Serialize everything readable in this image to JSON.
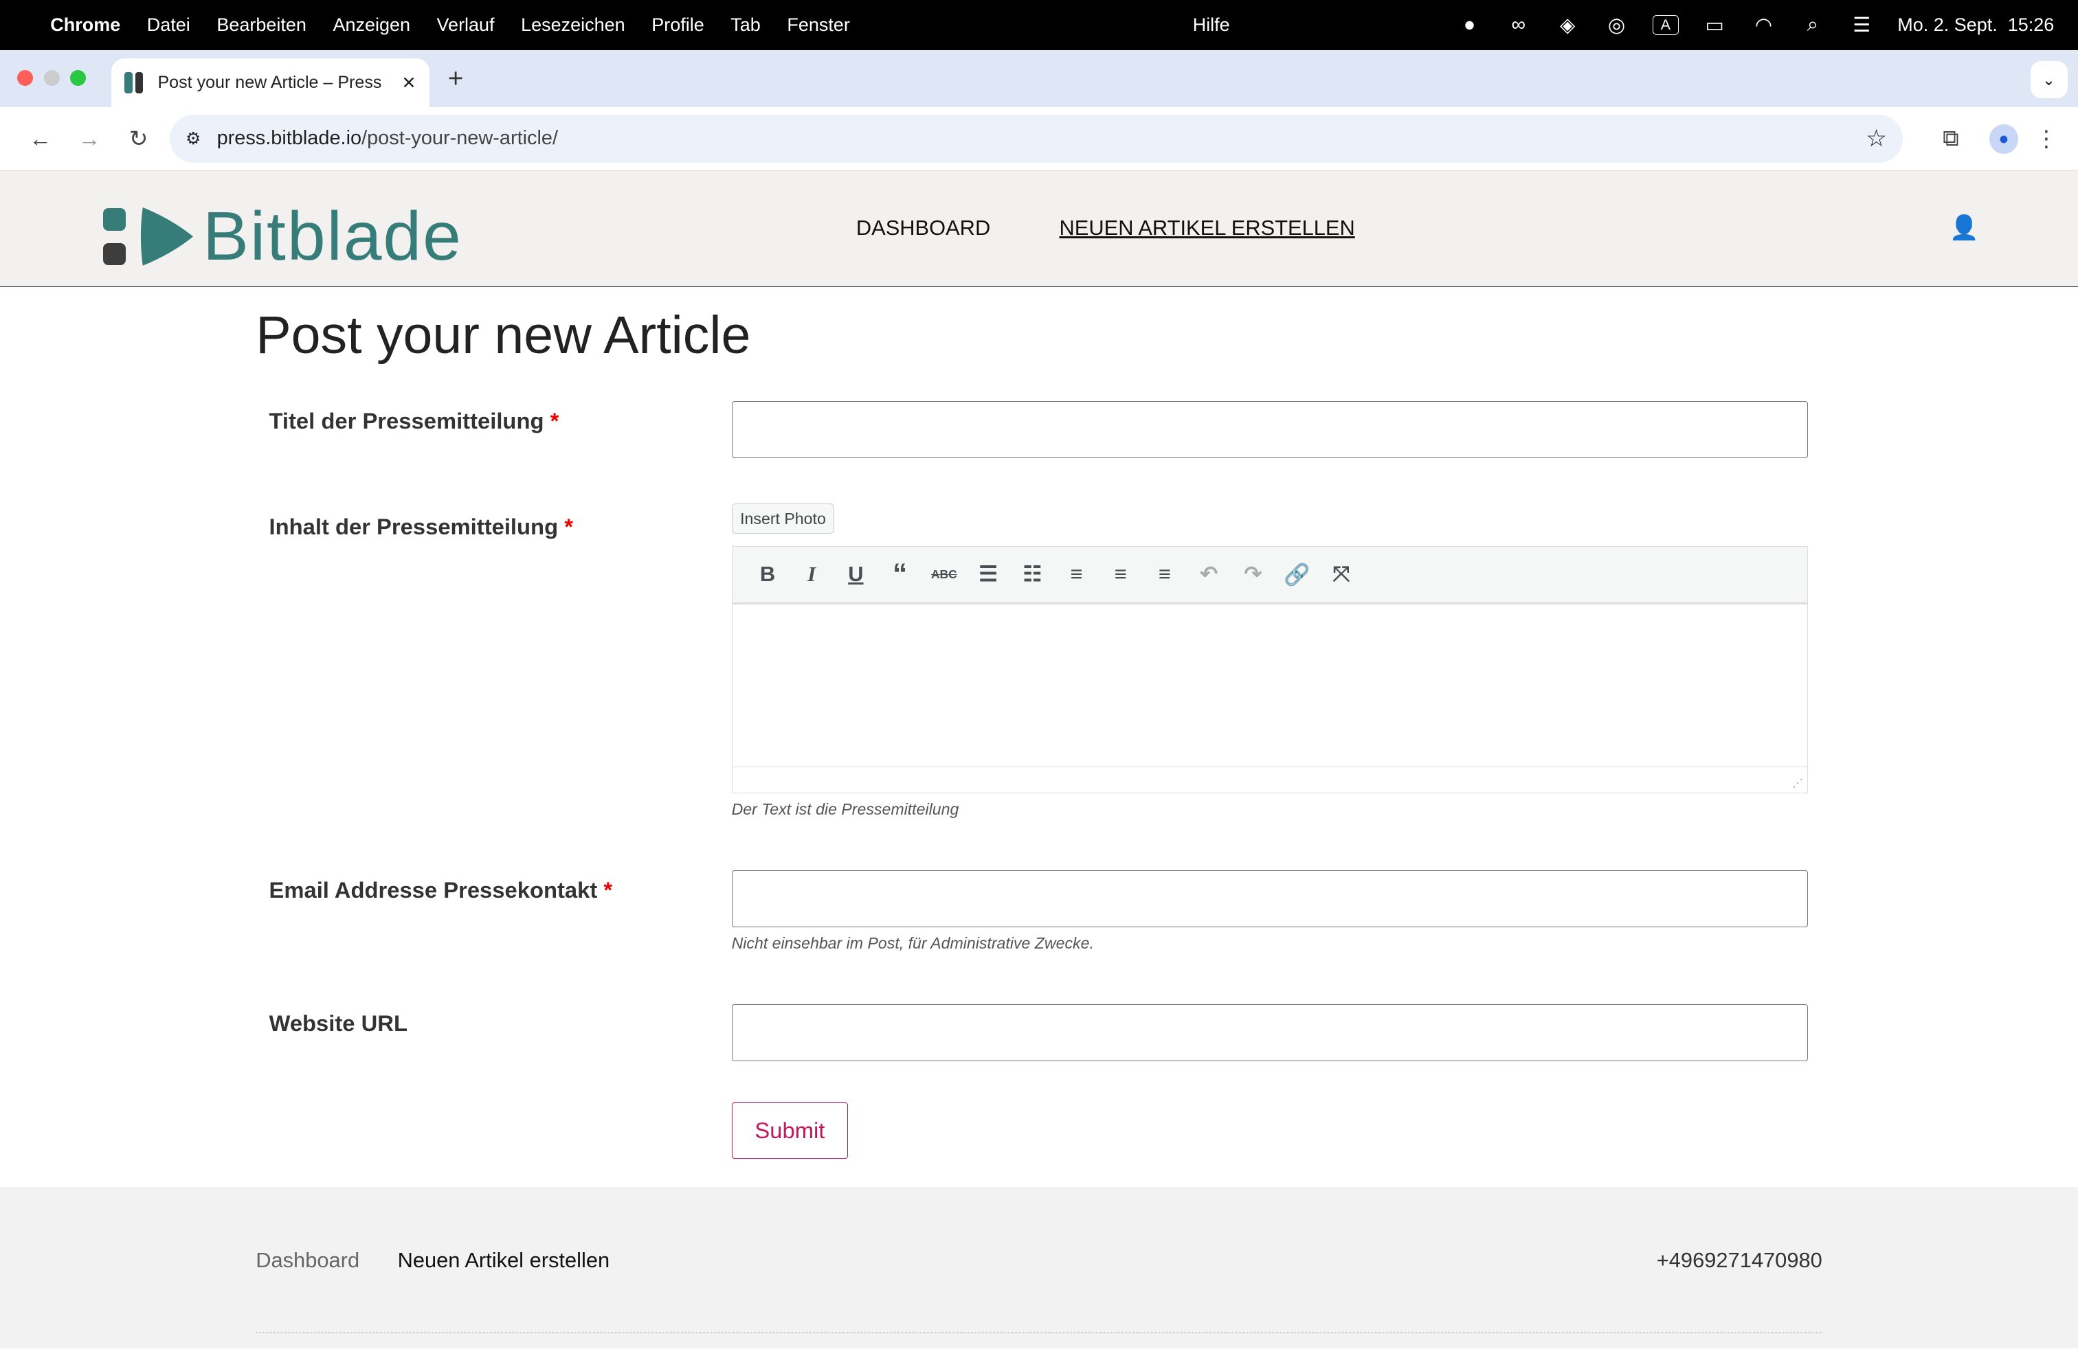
{
  "menubar": {
    "app": "Chrome",
    "items": [
      "Datei",
      "Bearbeiten",
      "Anzeigen",
      "Verlauf",
      "Lesezeichen",
      "Profile",
      "Tab",
      "Fenster"
    ],
    "help": "Hilfe",
    "clock": "Mo. 2. Sept.  15:26",
    "status_icons": [
      "wechat-icon",
      "meta-icon",
      "layers-icon",
      "vpn-lock-icon",
      "input-source-icon",
      "battery-charging-icon",
      "wifi-icon",
      "search-icon",
      "control-center-icon"
    ]
  },
  "browser": {
    "tab_title": "Post your new Article – Press",
    "url_host": "press.bitblade.io",
    "url_path": "/post-your-new-article/"
  },
  "site": {
    "logo": "Bitblade",
    "brand_color": "#367d7a",
    "nav": [
      "DASHBOARD",
      "NEUEN ARTIKEL ERSTELLEN"
    ]
  },
  "page": {
    "title": "Post your new Article"
  },
  "form": {
    "title_label": "Titel der Pressemitteilung",
    "title_value": "",
    "content_label": "Inhalt der Pressemitteilung",
    "insert_photo": "Insert Photo",
    "content_help": "Der Text ist die Pressemitteilung",
    "email_label": "Email Addresse Pressekontakt",
    "email_value": "",
    "email_help": "Nicht einsehbar im Post, für Administrative Zwecke.",
    "url_label": "Website URL",
    "url_value": "",
    "required_mark": "*",
    "submit": "Submit",
    "accent_color": "#c2185b"
  },
  "editor_toolbar": [
    "bold",
    "italic",
    "underline",
    "blockquote",
    "strikethrough",
    "bullet-list",
    "numbered-list",
    "align-left",
    "align-center",
    "align-right",
    "undo",
    "redo",
    "link",
    "fullscreen"
  ],
  "footer": {
    "links": [
      "Dashboard",
      "Neuen Artikel erstellen"
    ],
    "phone": "+4969271470980"
  }
}
